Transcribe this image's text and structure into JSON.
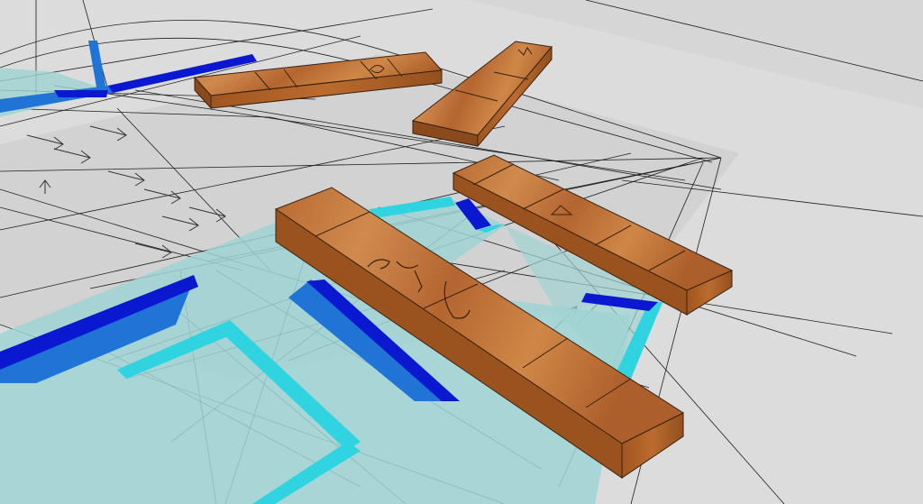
{
  "scene": {
    "kind": "3d-model-viewport",
    "style": "sketch perspective view",
    "colors": {
      "background": "#d9d9d9",
      "construction_line": "#1a1a1a",
      "glass_fill": "#9fd3d3",
      "cyan_band": "#2fd4e0",
      "blue_band": "#1f74d6",
      "navy_band": "#0a18d0",
      "wood_light": "#c2763a",
      "wood_dark": "#8a4a1c",
      "wood_edge": "#3a2210"
    },
    "objects": [
      {
        "name": "wood-plank-front",
        "material": "wood"
      },
      {
        "name": "wood-plank-right",
        "material": "wood"
      },
      {
        "name": "wood-plank-top-left",
        "material": "wood"
      },
      {
        "name": "wood-plank-top-right",
        "material": "wood"
      },
      {
        "name": "glass-platform",
        "material": "translucent-cyan"
      }
    ]
  }
}
